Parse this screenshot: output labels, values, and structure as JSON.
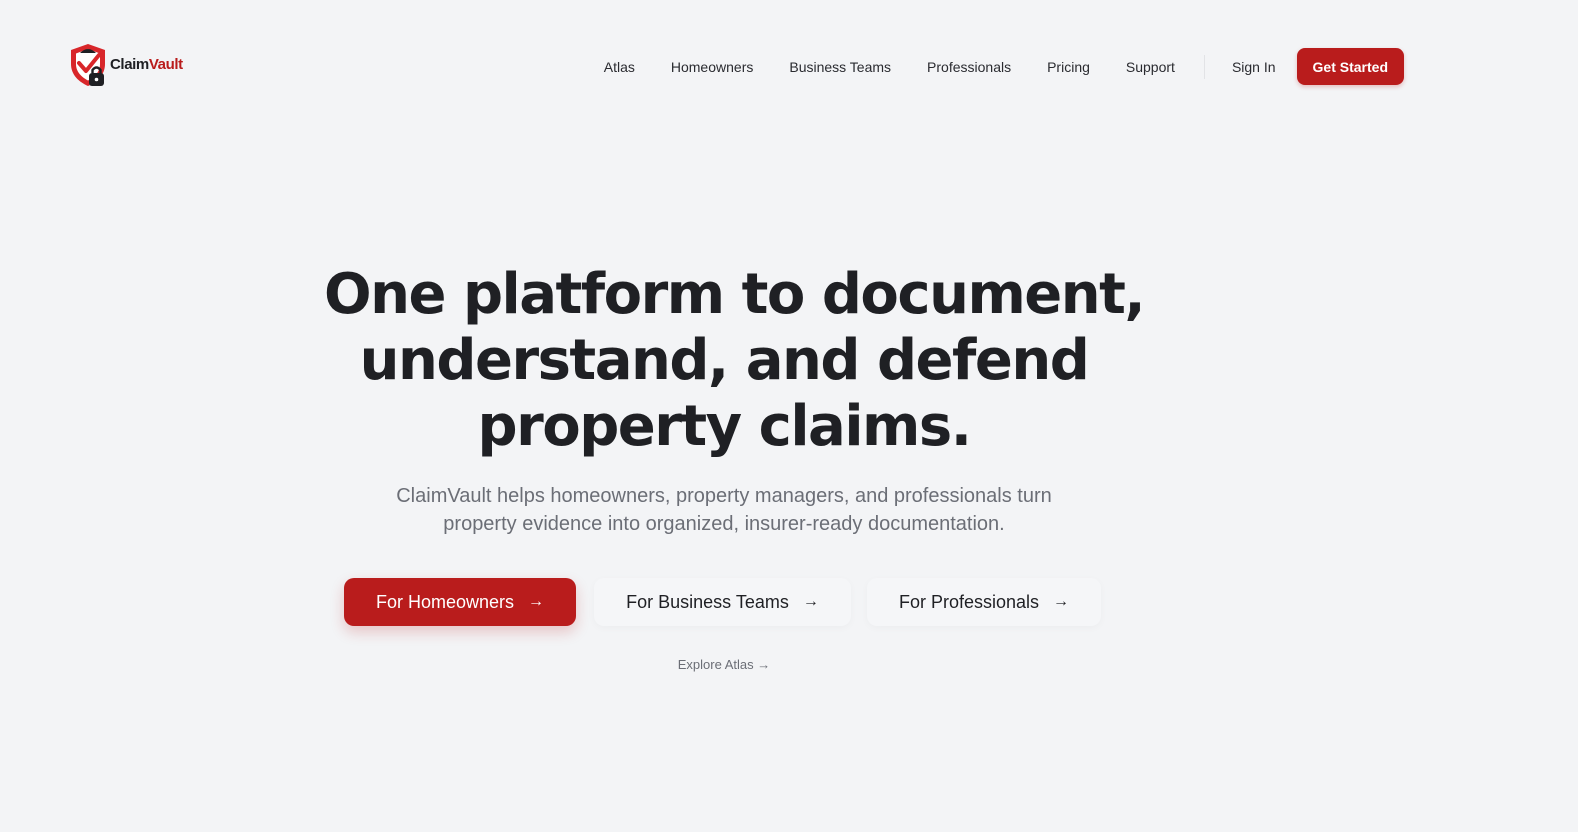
{
  "brand": {
    "name_part1": "Claim",
    "name_part2": "Vault",
    "logo_icon": "shield-lock-icon",
    "accent_color": "#b91c1c"
  },
  "nav": {
    "items": [
      "Atlas",
      "Homeowners",
      "Business Teams",
      "Professionals",
      "Pricing",
      "Support"
    ],
    "sign_in": "Sign In",
    "cta": "Get Started"
  },
  "hero": {
    "title_lines": [
      "One platform to document,",
      "understand, and defend",
      "property claims."
    ],
    "subtitle_lines": [
      "ClaimVault helps homeowners, property managers, and professionals turn",
      "property evidence into organized, insurer-ready documentation."
    ]
  },
  "ctas": [
    {
      "label": "For Homeowners",
      "arrow": "→"
    },
    {
      "label": "For Business Teams",
      "arrow": "→"
    },
    {
      "label": "For Professionals",
      "arrow": "→"
    }
  ],
  "explore": {
    "label": "Explore Atlas →"
  }
}
